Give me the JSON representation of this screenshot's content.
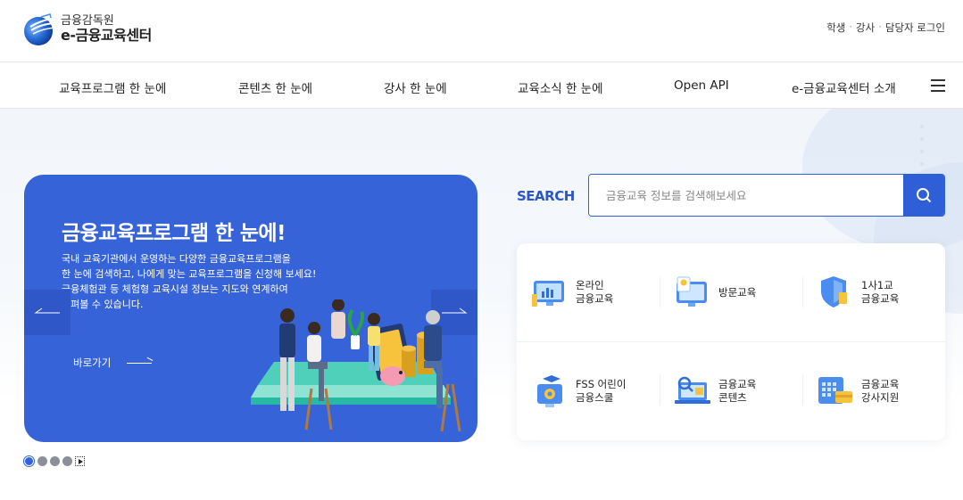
{
  "header": {
    "org_name": "금융감독원",
    "site_name": "e-금융교육센터",
    "util_links": [
      "학생",
      "강사",
      "담당자 로그인"
    ],
    "util_separator": "·"
  },
  "nav": {
    "items": [
      "교육프로그램 한 눈에",
      "콘텐츠 한 눈에",
      "강사 한 눈에",
      "교육소식 한 눈에",
      "Open API",
      "e-금융교육센터 소개"
    ]
  },
  "banner": {
    "title": "금융교육프로그램 한 눈에!",
    "desc_lines": [
      "국내 교육기관에서 운영하는 다양한 금융교육프로그램을",
      "한 눈에 검색하고, 나에게 맞는 교육프로그램을 신청해 보세요!",
      "금융체험관 등 체험형 교육시설 정보는 지도와 연계하여",
      "살펴볼 수 있습니다."
    ],
    "go_label": "바로가기",
    "slide_count": 4,
    "active_slide": 1
  },
  "search": {
    "label": "SEARCH",
    "placeholder": "금융교육 정보를 검색해보세요"
  },
  "quick_menu": [
    {
      "icon": "monitor-chart-icon",
      "lines": [
        "온라인",
        "금융교육"
      ]
    },
    {
      "icon": "visit-monitor-icon",
      "lines": [
        "방문교육"
      ]
    },
    {
      "icon": "shield-icon",
      "lines": [
        "1사1교",
        "금융교육"
      ]
    },
    {
      "icon": "school-icon",
      "lines": [
        "FSS 어린이",
        "금융스쿨"
      ]
    },
    {
      "icon": "laptop-search-icon",
      "lines": [
        "금융교육",
        "콘텐츠"
      ]
    },
    {
      "icon": "calendar-card-icon",
      "lines": [
        "금융교육",
        "강사지원"
      ]
    }
  ],
  "colors": {
    "primary": "#2f5fd6",
    "banner_bg": "#3763d9",
    "search_label": "#2a56c9"
  }
}
